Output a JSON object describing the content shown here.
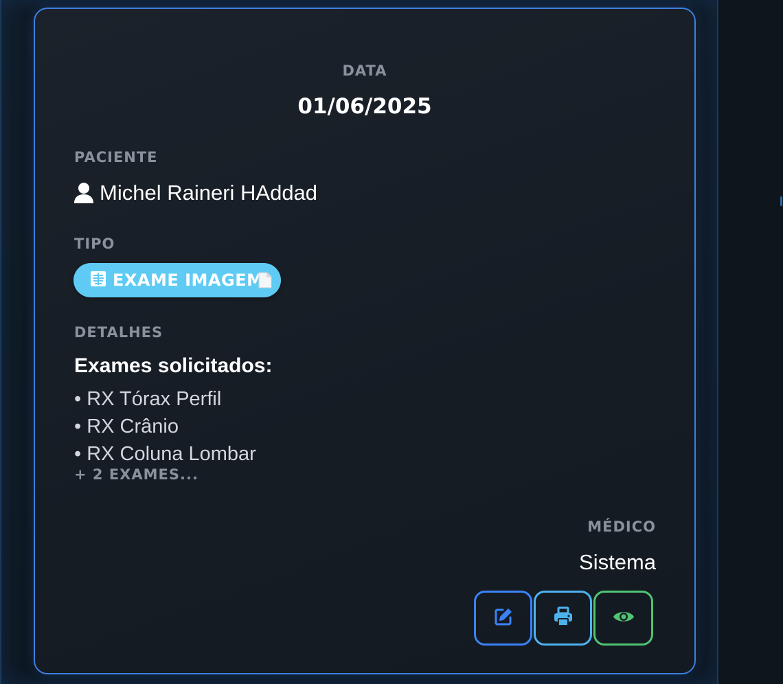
{
  "card": {
    "date_label": "DATA",
    "date_value": "01/06/2025",
    "patient_label": "PACIENTE",
    "patient_name": "Michel Raineri HAddad",
    "type_label": "TIPO",
    "type_badge": "EXAME IMAGEM",
    "details_label": "DETALHES",
    "details_title": "Exames solicitados:",
    "exams": [
      "• RX Tórax Perfil",
      "• RX Crânio",
      "• RX Coluna Lombar"
    ],
    "more_exams": "+ 2 EXAMES...",
    "doctor_label": "MÉDICO",
    "doctor_name": "Sistema"
  },
  "icons": {
    "patient": "user-icon",
    "type": "x-ray-icon",
    "type_suffix": "document-icon",
    "edit": "edit-icon",
    "print": "print-icon",
    "view": "eye-icon"
  },
  "colors": {
    "card_border": "#3e7fe0",
    "badge_background": "#5fcbf4",
    "edit_button": "#3b82f6",
    "print_button": "#4db3ee",
    "view_button": "#4fc471"
  }
}
